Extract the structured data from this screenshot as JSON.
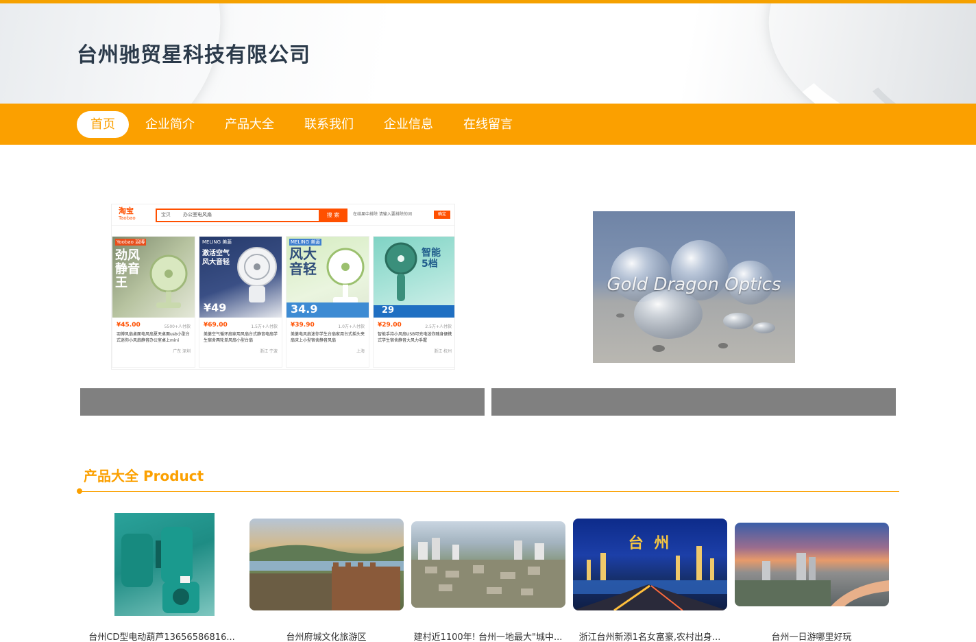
{
  "header": {
    "company_name": "台州驰贸星科技有限公司"
  },
  "nav": {
    "items": [
      {
        "label": "首页",
        "active": true
      },
      {
        "label": "企业简介",
        "active": false
      },
      {
        "label": "产品大全",
        "active": false
      },
      {
        "label": "联系我们",
        "active": false
      },
      {
        "label": "企业信息",
        "active": false
      },
      {
        "label": "在线留言",
        "active": false
      }
    ]
  },
  "banners": [
    {
      "type": "taobao-search-screenshot",
      "logo": "淘宝",
      "logo_sub": "Taobao",
      "search_category": "宝贝",
      "search_query": "办公室电风扇",
      "search_button": "搜 索",
      "filter_text": "在结果中排除 请输入要排除的词",
      "filter_button": "确定",
      "products": [
        {
          "price": "¥45.00",
          "sold": "5500+人付款",
          "desc": "羽博风扇桌面电风扇夏天桌面usb小型台式迷你小风扇静音办公室桌上mini",
          "location": "广东 深圳",
          "headline": "劲风 静音王",
          "brand": "Yoobao 羽博"
        },
        {
          "price": "¥69.00",
          "sold": "1.5万+人付款",
          "desc": "美菱空气循环扇家用风扇台式静音电扇学生宿舍两轮单风扇小型台扇",
          "location": "浙江 宁波",
          "headline": "激活空气 风大音轻",
          "brand": "MELING 美菱",
          "promo": "¥49"
        },
        {
          "price": "¥39.90",
          "sold": "1.0万+人付款",
          "desc": "美菱电风扇迷你学生台扇家用台式摇头夹扇床上小型宿舍静音风扇",
          "location": "上海",
          "headline": "风大 音轻",
          "brand": "MELING 美菱",
          "promo": "34.9"
        },
        {
          "price": "¥29.00",
          "sold": "2.5万+人付款",
          "desc": "智能手持小风扇USB可充电迷你随身便携式学生宿舍静音大风力手握",
          "location": "浙江 杭州",
          "headline": "智能 5档",
          "promo": "29"
        }
      ]
    },
    {
      "type": "optics-photo",
      "overlay_text": "Gold Dragon Optics"
    }
  ],
  "products_section": {
    "title": "产品大全 Product",
    "items": [
      {
        "caption": "台州CD型电动葫芦13656586816...",
        "image": "electric-hoist"
      },
      {
        "caption": "台州府城文化旅游区",
        "image": "city-wall"
      },
      {
        "caption": "建村近1100年! 台州一地最大\"城中...",
        "image": "village-aerial"
      },
      {
        "caption": "浙江台州新添1名女富豪,农村出身...",
        "image": "taizhou-night",
        "overlay": "台 州"
      },
      {
        "caption": "台州一日游哪里好玩",
        "image": "river-sunset"
      }
    ]
  },
  "colors": {
    "accent": "#fba000",
    "caption_bar": "#808080",
    "title": "#2b3a4a"
  }
}
